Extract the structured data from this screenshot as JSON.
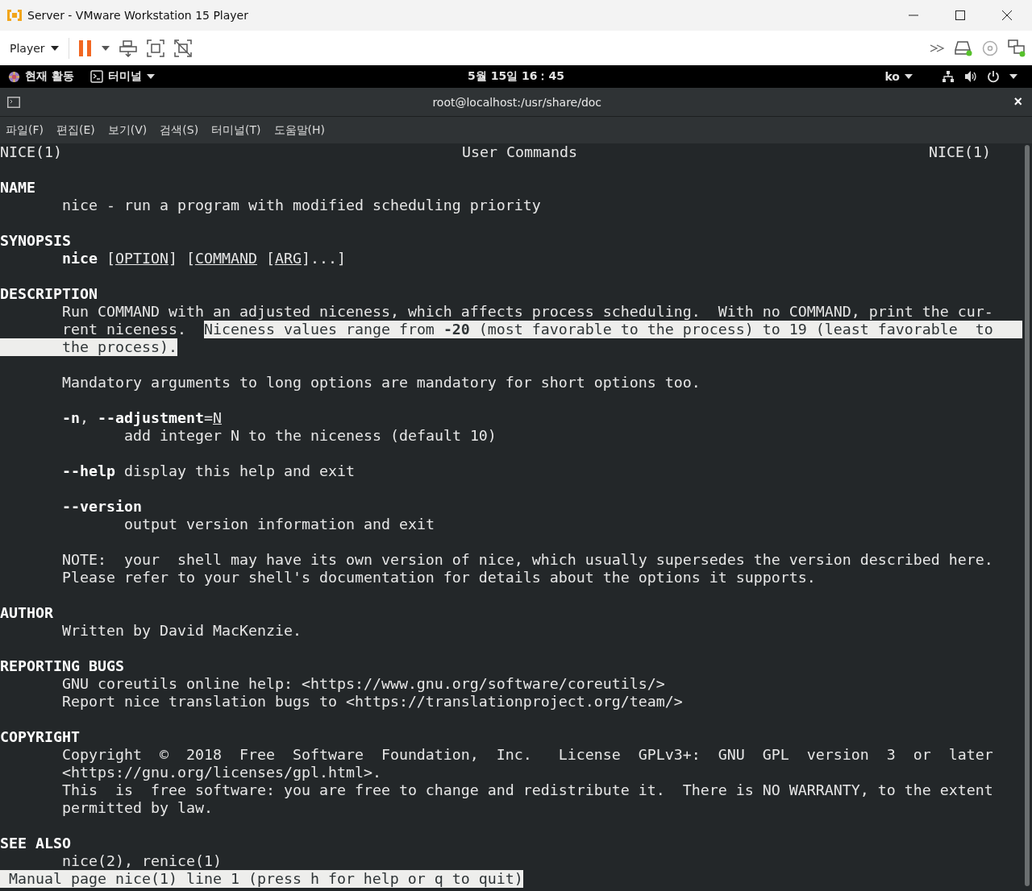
{
  "window": {
    "title": "Server - VMware Workstation 15 Player"
  },
  "toolbar": {
    "menu": "Player"
  },
  "top_bar": {
    "activities": "현재 활동",
    "app": "터미널",
    "clock": "5월 15일 16：45",
    "input_method": "ko"
  },
  "terminal": {
    "title": "root@localhost:/usr/share/doc",
    "close": "×",
    "menu": [
      "파일(F)",
      "편집(E)",
      "보기(V)",
      "검색(S)",
      "터미널(T)",
      "도움말(H)"
    ],
    "header": {
      "left": "NICE(1)",
      "center": "User Commands",
      "right": "NICE(1)"
    },
    "blocks": [
      {
        "lines": [
          {
            "kind": "heading",
            "spans": [
              {
                "text": "NAME",
                "kind": "bold",
                "selected": false
              }
            ]
          },
          {
            "kind": "body",
            "spans": [
              {
                "text": "nice - run a program with modified scheduling priority",
                "kind": "plain",
                "selected": false
              }
            ]
          }
        ]
      },
      {
        "lines": [
          {
            "kind": "heading",
            "spans": [
              {
                "text": "SYNOPSIS",
                "kind": "bold",
                "selected": false
              }
            ]
          },
          {
            "kind": "body",
            "spans": [
              {
                "text": "nice",
                "kind": "bold",
                "selected": false
              },
              {
                "text": " [",
                "kind": "plain",
                "selected": false
              },
              {
                "text": "OPTION",
                "kind": "underline",
                "selected": false
              },
              {
                "text": "] [",
                "kind": "plain",
                "selected": false
              },
              {
                "text": "COMMAND",
                "kind": "underline",
                "selected": false
              },
              {
                "text": " [",
                "kind": "plain",
                "selected": false
              },
              {
                "text": "ARG",
                "kind": "underline",
                "selected": false
              },
              {
                "text": "]...]",
                "kind": "plain",
                "selected": false
              }
            ]
          }
        ]
      },
      {
        "lines": [
          {
            "kind": "heading",
            "spans": [
              {
                "text": "DESCRIPTION",
                "kind": "bold",
                "selected": false
              }
            ]
          },
          {
            "kind": "body",
            "spans": [
              {
                "text": "Run COMMAND with an adjusted niceness, which affects process scheduling.  With no COMMAND, print the cur‐",
                "kind": "plain",
                "selected": false
              }
            ]
          },
          {
            "kind": "body",
            "spans": [
              {
                "text": "rent niceness.  ",
                "kind": "plain",
                "selected": false
              },
              {
                "text": "Niceness values range from ",
                "kind": "plain",
                "selected": true
              },
              {
                "text": "-20",
                "kind": "bold",
                "selected": true
              },
              {
                "text": " (most favorable to the process) to 19 (least favorable  to",
                "kind": "plain",
                "selected": true
              }
            ]
          },
          {
            "kind": "body",
            "spans": [
              {
                "text": "the process).",
                "kind": "plain",
                "selected": true
              }
            ]
          }
        ]
      },
      {
        "lines": [
          {
            "kind": "body",
            "spans": [
              {
                "text": "Mandatory arguments to long options are mandatory for short options too.",
                "kind": "plain",
                "selected": false
              }
            ]
          }
        ]
      },
      {
        "lines": [
          {
            "kind": "body",
            "spans": [
              {
                "text": "-n",
                "kind": "bold",
                "selected": false
              },
              {
                "text": ", ",
                "kind": "plain",
                "selected": false
              },
              {
                "text": "--adjustment",
                "kind": "bold",
                "selected": false
              },
              {
                "text": "=",
                "kind": "plain",
                "selected": false
              },
              {
                "text": "N",
                "kind": "underline",
                "selected": false
              }
            ]
          },
          {
            "kind": "sub",
            "spans": [
              {
                "text": "add integer N to the niceness (default 10)",
                "kind": "plain",
                "selected": false
              }
            ]
          }
        ]
      },
      {
        "lines": [
          {
            "kind": "body",
            "spans": [
              {
                "text": "--help",
                "kind": "bold",
                "selected": false
              },
              {
                "text": " display this help and exit",
                "kind": "plain",
                "selected": false
              }
            ]
          }
        ]
      },
      {
        "lines": [
          {
            "kind": "body",
            "spans": [
              {
                "text": "--version",
                "kind": "bold",
                "selected": false
              }
            ]
          },
          {
            "kind": "sub",
            "spans": [
              {
                "text": "output version information and exit",
                "kind": "plain",
                "selected": false
              }
            ]
          }
        ]
      },
      {
        "lines": [
          {
            "kind": "body",
            "spans": [
              {
                "text": "NOTE:  your  shell may have its own version of nice, which usually supersedes the version described here.",
                "kind": "plain",
                "selected": false
              }
            ]
          },
          {
            "kind": "body",
            "spans": [
              {
                "text": "Please refer to your shell's documentation for details about the options it supports.",
                "kind": "plain",
                "selected": false
              }
            ]
          }
        ]
      },
      {
        "lines": [
          {
            "kind": "heading",
            "spans": [
              {
                "text": "AUTHOR",
                "kind": "bold",
                "selected": false
              }
            ]
          },
          {
            "kind": "body",
            "spans": [
              {
                "text": "Written by David MacKenzie.",
                "kind": "plain",
                "selected": false
              }
            ]
          }
        ]
      },
      {
        "lines": [
          {
            "kind": "heading",
            "spans": [
              {
                "text": "REPORTING BUGS",
                "kind": "bold",
                "selected": false
              }
            ]
          },
          {
            "kind": "body",
            "spans": [
              {
                "text": "GNU coreutils online help: <https://www.gnu.org/software/coreutils/>",
                "kind": "plain",
                "selected": false
              }
            ]
          },
          {
            "kind": "body",
            "spans": [
              {
                "text": "Report nice translation bugs to <https://translationproject.org/team/>",
                "kind": "plain",
                "selected": false
              }
            ]
          }
        ]
      },
      {
        "lines": [
          {
            "kind": "heading",
            "spans": [
              {
                "text": "COPYRIGHT",
                "kind": "bold",
                "selected": false
              }
            ]
          },
          {
            "kind": "body",
            "spans": [
              {
                "text": "Copyright  ©  2018  Free  Software  Foundation,  Inc.   License  GPLv3+:  GNU  GPL  version  3  or  later",
                "kind": "plain",
                "selected": false
              }
            ]
          },
          {
            "kind": "body",
            "spans": [
              {
                "text": "<https://gnu.org/licenses/gpl.html>.",
                "kind": "plain",
                "selected": false
              }
            ]
          },
          {
            "kind": "body",
            "spans": [
              {
                "text": "This  is  free software: you are free to change and redistribute it.  There is NO WARRANTY, to the extent",
                "kind": "plain",
                "selected": false
              }
            ]
          },
          {
            "kind": "body",
            "spans": [
              {
                "text": "permitted by law.",
                "kind": "plain",
                "selected": false
              }
            ]
          }
        ]
      },
      {
        "lines": [
          {
            "kind": "heading",
            "spans": [
              {
                "text": "SEE ALSO",
                "kind": "bold",
                "selected": false
              }
            ]
          },
          {
            "kind": "body",
            "spans": [
              {
                "text": "nice(2), renice(1)",
                "kind": "plain",
                "selected": false
              }
            ]
          }
        ]
      }
    ],
    "status": "Manual page nice(1) line 1 (press h for help or q to quit)"
  }
}
